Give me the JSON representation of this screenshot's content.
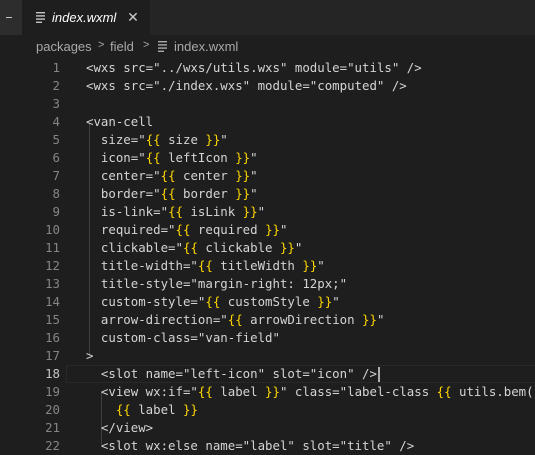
{
  "tab": {
    "title": "index.wxml",
    "icon": "lines-file-icon",
    "close_icon": "close-icon"
  },
  "breadcrumb": {
    "items": [
      "packages",
      "field",
      "index.wxml"
    ],
    "separator": ">"
  },
  "editor": {
    "current_line": 18,
    "lines": [
      {
        "n": "1",
        "text": "<wxs src=\"../wxs/utils.wxs\" module=\"utils\" />"
      },
      {
        "n": "2",
        "text": "<wxs src=\"./index.wxs\" module=\"computed\" />"
      },
      {
        "n": "3",
        "text": ""
      },
      {
        "n": "4",
        "text": "<van-cell"
      },
      {
        "n": "5",
        "text": "  size=\"{{ size }}\""
      },
      {
        "n": "6",
        "text": "  icon=\"{{ leftIcon }}\""
      },
      {
        "n": "7",
        "text": "  center=\"{{ center }}\""
      },
      {
        "n": "8",
        "text": "  border=\"{{ border }}\""
      },
      {
        "n": "9",
        "text": "  is-link=\"{{ isLink }}\""
      },
      {
        "n": "10",
        "text": "  required=\"{{ required }}\""
      },
      {
        "n": "11",
        "text": "  clickable=\"{{ clickable }}\""
      },
      {
        "n": "12",
        "text": "  title-width=\"{{ titleWidth }}\""
      },
      {
        "n": "13",
        "text": "  title-style=\"margin-right: 12px;\""
      },
      {
        "n": "14",
        "text": "  custom-style=\"{{ customStyle }}\""
      },
      {
        "n": "15",
        "text": "  arrow-direction=\"{{ arrowDirection }}\""
      },
      {
        "n": "16",
        "text": "  custom-class=\"van-field\""
      },
      {
        "n": "17",
        "text": ">"
      },
      {
        "n": "18",
        "text": "  <slot name=\"left-icon\" slot=\"icon\" />"
      },
      {
        "n": "19",
        "text": "  <view wx:if=\"{{ label }}\" class=\"label-class {{ utils.bem('f"
      },
      {
        "n": "20",
        "text": "    {{ label }}"
      },
      {
        "n": "21",
        "text": "  </view>"
      },
      {
        "n": "22",
        "text": "  <slot wx:else name=\"label\" slot=\"title\" />"
      }
    ]
  },
  "colors": {
    "background": "#1e1e1e",
    "tabbar": "#252526",
    "text": "#d4d4d4",
    "line_number": "#858585",
    "brace": "#ffd700"
  }
}
